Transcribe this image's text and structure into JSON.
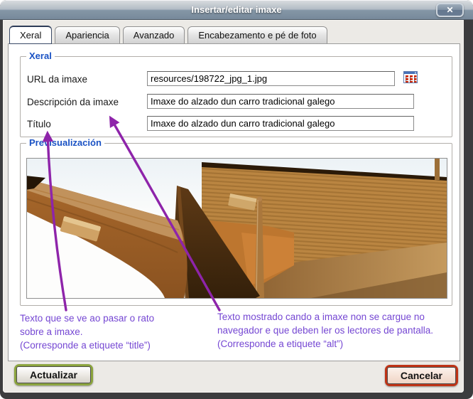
{
  "window": {
    "title": "Insertar/editar imaxe",
    "close": "✕"
  },
  "tabs": [
    {
      "label": "Xeral",
      "active": true
    },
    {
      "label": "Apariencia",
      "active": false
    },
    {
      "label": "Avanzado",
      "active": false
    },
    {
      "label": "Encabezamento e pé de foto",
      "active": false
    }
  ],
  "general": {
    "legend": "Xeral",
    "url_field": {
      "label": "URL da imaxe",
      "value": "resources/198722_jpg_1.jpg",
      "browse_icon": "file-browser-icon"
    },
    "description_field": {
      "label": "Descripción da imaxe",
      "value": "Imaxe do alzado dun carro tradicional galego"
    },
    "title_field": {
      "label": "Título",
      "value": "Imaxe do alzado dun carro tradicional galego"
    }
  },
  "preview": {
    "legend": "Previsualización",
    "image_description": "Vista 3D en madeira do alzado dun carro tradicional galego"
  },
  "notes": {
    "title_note": {
      "line1": "Texto que se ve ao pasar o rato",
      "line2": "sobre a imaxe.",
      "line3": "(Corresponde a etiquete “title”)"
    },
    "alt_note": {
      "line1": "Texto mostrado cando a imaxe non se cargue no",
      "line2": "navegador e que deben ler os lectores de pantalla.",
      "line3": "(Corresponde a etiquete “alt”)"
    }
  },
  "buttons": {
    "update": "Actualizar",
    "cancel": "Cancelar"
  },
  "colors": {
    "legend_blue": "#1a52c4",
    "note_purple": "#7547d3",
    "arrow_purple": "#8e24aa",
    "update_green": "#8ba43d",
    "cancel_red": "#bf3417",
    "titlebar_slate": "#76889a"
  }
}
